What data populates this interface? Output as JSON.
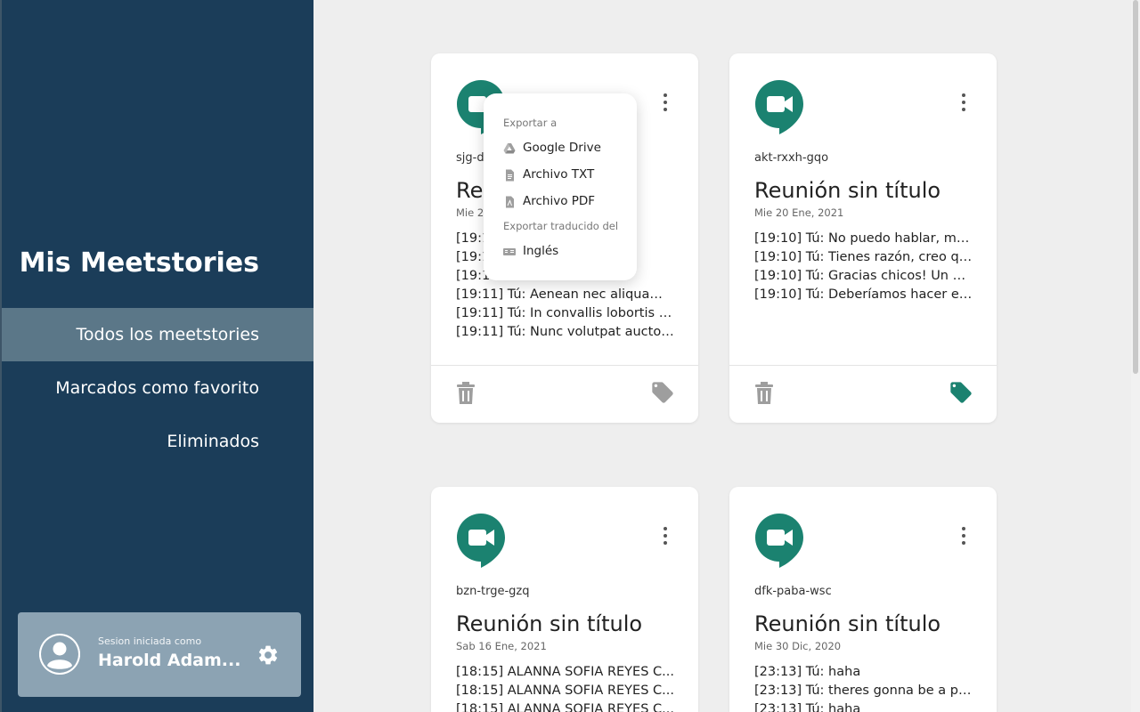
{
  "sidebar": {
    "title": "Mis Meetstories",
    "nav": [
      {
        "label": "Todos los meetstories"
      },
      {
        "label": "Marcados como favorito"
      },
      {
        "label": "Eliminados"
      }
    ],
    "user": {
      "caption": "Sesion iniciada como",
      "name": "Harold Adam..."
    }
  },
  "cards": [
    {
      "code": "sjg-d",
      "title": "Reu",
      "date": "Mie 20",
      "lines": [
        "[19:1                                    or sit...",
        "[19:1                                    us ...",
        "[19:1                                    iben...",
        "[19:11] Tú: Aenean nec aliquam ...",
        "[19:11] Tú: In convallis lobortis di...",
        "[19:11] Tú: Nunc volutpat auctor ..."
      ]
    },
    {
      "code": "akt-rxxh-gqo",
      "title": "Reunión sin título",
      "date": "Mie 20 Ene, 2021",
      "lines": [
        "[19:10] Tú: No puedo hablar, mi ...",
        "[19:10] Tú: Tienes razón, creo qu...",
        "[19:10] Tú: Gracias chicos! Un ab...",
        "[19:10] Tú: Deberíamos hacer est..."
      ]
    },
    {
      "code": "bzn-trge-gzq",
      "title": "Reunión sin título",
      "date": "Sab 16 Ene, 2021",
      "lines": [
        "[18:15] ALANNA SOFIA REYES C...",
        "[18:15] ALANNA SOFIA REYES C...",
        "[18:15] ALANNA SOFIA REYES C..."
      ]
    },
    {
      "code": "dfk-paba-wsc",
      "title": "Reunión sin título",
      "date": "Mie 30 Dic, 2020",
      "lines": [
        "[23:13] Tú: haha",
        "[23:13] Tú: theres gonna be a pa...",
        "[23:13] Tú: haha"
      ]
    }
  ],
  "menu": {
    "export_header": "Exportar a",
    "items": [
      {
        "label": "Google Drive",
        "icon": "google-drive-icon"
      },
      {
        "label": "Archivo TXT",
        "icon": "txt-file-icon"
      },
      {
        "label": "Archivo PDF",
        "icon": "pdf-file-icon"
      }
    ],
    "translate_header": "Exportar traducido del",
    "translate_items": [
      {
        "label": "Inglés",
        "icon": "translate-icon"
      }
    ]
  },
  "colors": {
    "sidebar_bg": "#1b3d59",
    "active_nav": "#5b7788",
    "user_panel": "#8ca3b3",
    "meet_green": "#1b8270",
    "icon_gray": "#9e9e9e"
  }
}
